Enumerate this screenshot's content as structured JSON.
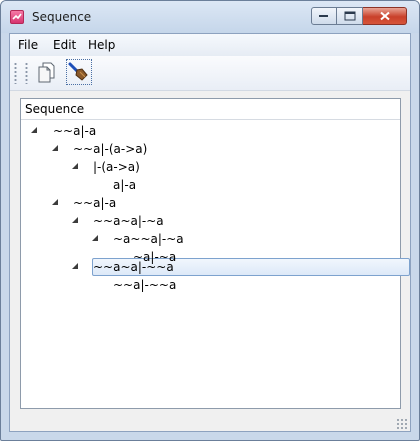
{
  "window": {
    "title": "Sequence"
  },
  "menu": [
    "File",
    "Edit",
    "Help"
  ],
  "toolbar": {
    "buttons": [
      {
        "icon": "copy-pages-icon"
      },
      {
        "icon": "brush-icon"
      }
    ]
  },
  "panel": {
    "title": "Sequence"
  },
  "tree": [
    {
      "text": "~~a|-a",
      "expandable": true
    },
    {
      "text": "~~a|-(a->a)",
      "expandable": true
    },
    {
      "text": "|-(a->a)",
      "expandable": true
    },
    {
      "text": "a|-a",
      "expandable": false
    },
    {
      "text": "~~a|-a",
      "expandable": true
    },
    {
      "text": "~~a~a|-~a",
      "expandable": true
    },
    {
      "text": "~a~~a|-~a",
      "expandable": true
    },
    {
      "text": "~a|-~a",
      "expandable": false
    },
    {
      "text": "~~a~a|-~~a",
      "expandable": true,
      "selected": true
    },
    {
      "text": "~~a|-~~a",
      "expandable": false
    }
  ],
  "colors": {
    "selection_border": "#7da2ce",
    "close_button": "#c9402a"
  }
}
